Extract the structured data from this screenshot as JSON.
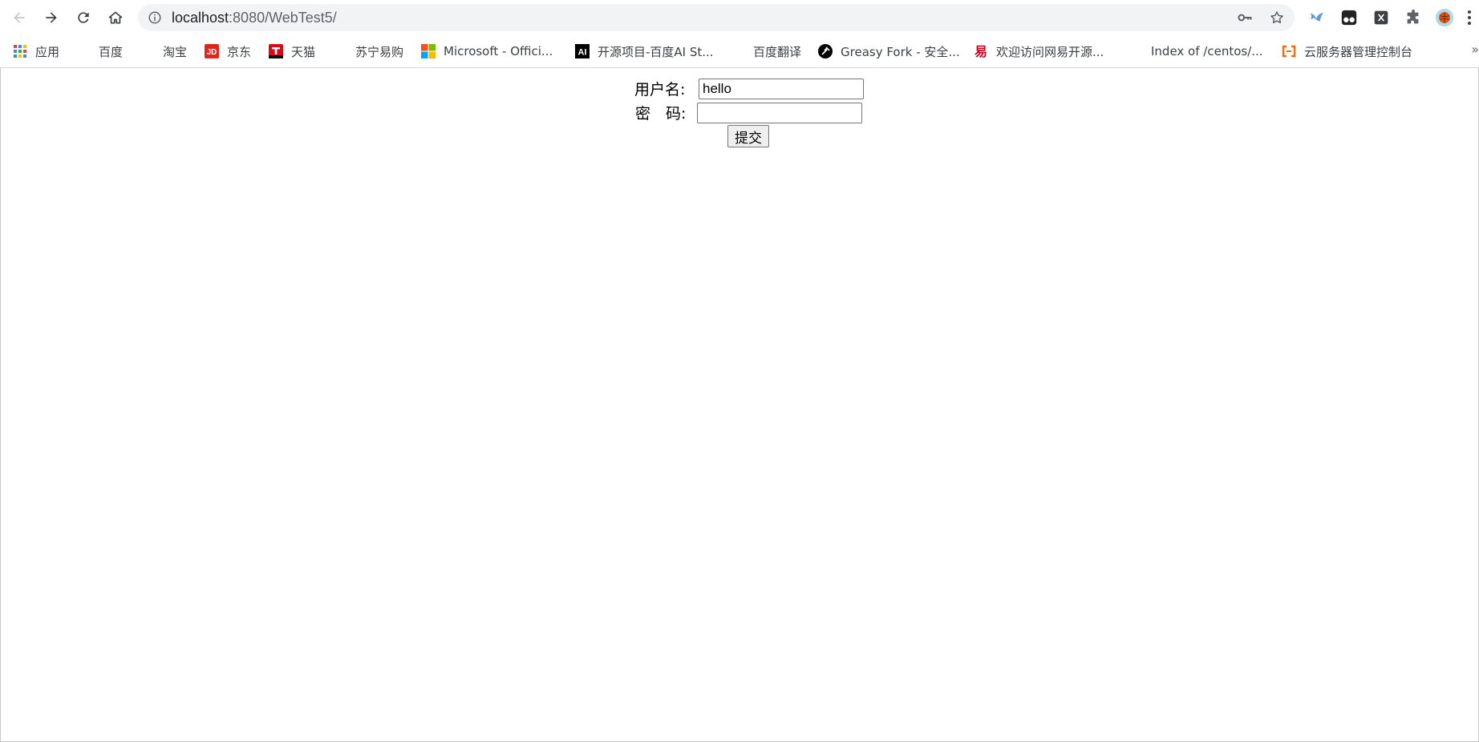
{
  "browser": {
    "url_host": "localhost",
    "url_rest": ":8080/WebTest5/",
    "icons": [
      "back-icon",
      "forward-icon",
      "reload-icon",
      "home-icon",
      "site-info-icon",
      "key-icon",
      "star-icon",
      "puzzle-icon",
      "profile-icon"
    ]
  },
  "bookmarks": [
    {
      "label": "应用",
      "icon": "apps-grid"
    },
    {
      "label": "百度",
      "icon": "globe"
    },
    {
      "label": "淘宝",
      "icon": "globe"
    },
    {
      "label": "京东",
      "icon": "jd"
    },
    {
      "label": "天猫",
      "icon": "tmall"
    },
    {
      "label": "苏宁易购",
      "icon": "globe"
    },
    {
      "label": "Microsoft - Offici...",
      "icon": "microsoft"
    },
    {
      "label": "开源项目-百度AI St...",
      "icon": "ai"
    },
    {
      "label": "百度翻译",
      "icon": "globe"
    },
    {
      "label": "Greasy Fork - 安全...",
      "icon": "greasyfork"
    },
    {
      "label": "欢迎访问网易开源...",
      "icon": "netease"
    },
    {
      "label": "Index of /centos/...",
      "icon": "globe"
    },
    {
      "label": "云服务器管理控制台",
      "icon": "aliyun"
    }
  ],
  "bookmarks_more": "»",
  "form": {
    "username_label": "用户名:",
    "username_value": "hello",
    "password_label": "密　码:",
    "password_value": "",
    "submit_label": "提交"
  },
  "colors": {
    "toolbar_bg": "#ffffff",
    "omnibox_bg": "#f1f3f4",
    "icon_gray": "#5f6368"
  }
}
